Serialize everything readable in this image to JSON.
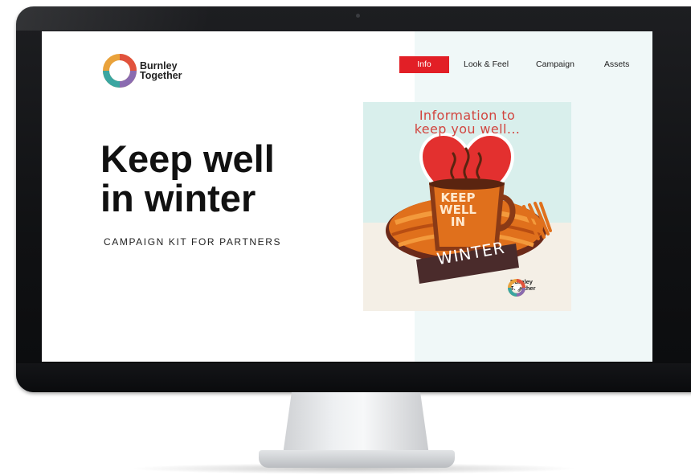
{
  "site": {
    "logo": {
      "line1": "Burnley",
      "line2": "Together",
      "icon": "heart-ring-logo"
    },
    "nav": [
      {
        "label": "Info",
        "active": true
      },
      {
        "label": "Look & Feel",
        "active": false
      },
      {
        "label": "Campaign",
        "active": false
      },
      {
        "label": "Assets",
        "active": false
      }
    ],
    "hero": {
      "title": "Keep well\nin winter",
      "subtitle": "CAMPAIGN KIT FOR PARTNERS"
    },
    "poster": {
      "heading": "Information to\nkeep you well...",
      "mug_text": "KEEP\nWELL\nIN",
      "banner_text": "WINTER",
      "logo_line1": "Burnley",
      "logo_line2": "Together"
    }
  },
  "colors": {
    "accent": "#e21f26",
    "poster_bg": "#d9efec",
    "heading_red": "#d2453f",
    "orange": "#e0701c"
  }
}
